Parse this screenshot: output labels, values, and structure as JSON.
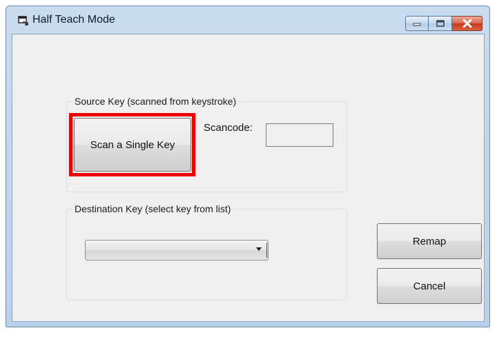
{
  "window": {
    "title": "Half Teach Mode",
    "icons": {
      "app": "window-icon",
      "minimize": "minimize-icon",
      "maximize": "maximize-icon",
      "close": "close-icon"
    }
  },
  "source_group": {
    "label": "Source Key (scanned from keystroke)",
    "scan_button": "Scan a Single Key",
    "scancode_label": "Scancode:",
    "scancode_value": ""
  },
  "destination_group": {
    "label": "Destination Key (select key from list)",
    "selected_value": ""
  },
  "buttons": {
    "remap": "Remap",
    "cancel": "Cancel"
  },
  "colors": {
    "highlight": "#ee0000",
    "close_button": "#c9391c",
    "titlebar": "#b9d1ea"
  }
}
